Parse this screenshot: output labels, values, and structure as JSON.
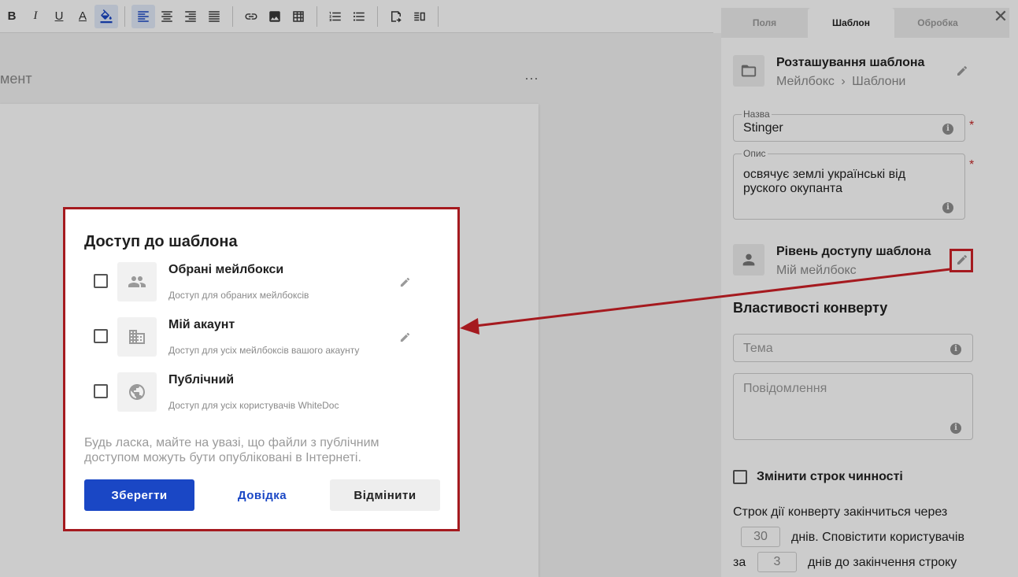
{
  "toolbar": {
    "bold": "B",
    "italic": "I",
    "underline": "U",
    "text_color": "A"
  },
  "document": {
    "title_fragment": "мент",
    "more": "⋯"
  },
  "panel": {
    "tabs": [
      {
        "label": "Поля"
      },
      {
        "label": "Шаблон"
      },
      {
        "label": "Обробка"
      }
    ],
    "close": "✕",
    "location": {
      "title": "Розташування шаблона",
      "path_root": "Мейлбокс",
      "path_sep": "›",
      "path_leaf": "Шаблони"
    },
    "name_field": {
      "label": "Назва",
      "value": "Stinger",
      "required": "*"
    },
    "desc_field": {
      "label": "Опис",
      "value_line1": "освячує землі українські від",
      "value_line2": "руского окупанта",
      "required": "*"
    },
    "access": {
      "title": "Рівень доступу шаблона",
      "value": "Мій мейлбокс"
    },
    "envelope_title": "Властивості конверту",
    "subject_placeholder": "Тема",
    "message_placeholder": "Повідомлення",
    "change_validity": "Змінити строк чинності",
    "expiry_text_1": "Строк дії конверту закінчиться через",
    "expiry_days": "30",
    "expiry_text_2": "днів. Сповістити користувачів",
    "expiry_text_3": "за",
    "notify_days": "3",
    "expiry_text_4": "днів до закінчення строку"
  },
  "modal": {
    "title": "Доступ до шаблона",
    "options": [
      {
        "title": "Обрані мейлбокси",
        "subtitle": "Доступ для обраних мейлбоксів"
      },
      {
        "title": "Мій акаунт",
        "subtitle": "Доступ для усіх мейлбоксів вашого акаунту"
      },
      {
        "title": "Публічний",
        "subtitle": "Доступ для усіх користувачів WhiteDoc"
      }
    ],
    "note": "Будь ласка, майте на увазі, що файли з публічним доступом можуть бути опубліковані в Інтернеті.",
    "save": "Зберегти",
    "help": "Довідка",
    "cancel": "Відмінити"
  },
  "colors": {
    "accent": "#1a47c5",
    "annotation": "#a51a1f",
    "required": "#c62828"
  }
}
